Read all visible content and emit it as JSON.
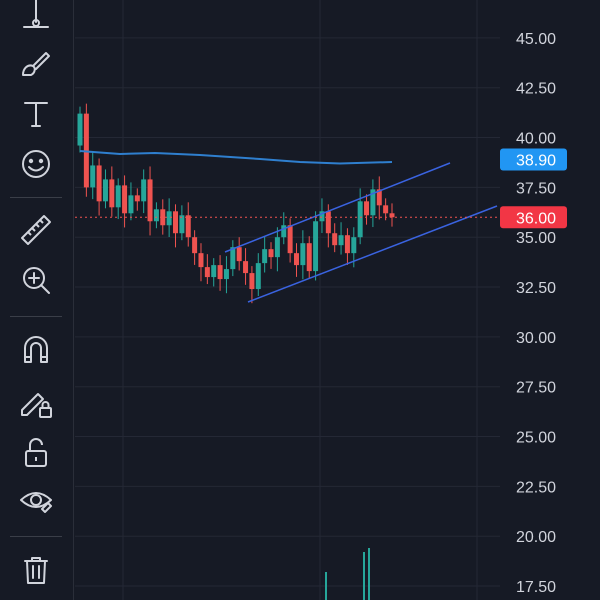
{
  "toolbar": {
    "tools": [
      {
        "name": "vertical-line-tool-icon"
      },
      {
        "name": "brush-tool-icon"
      },
      {
        "name": "text-tool-icon"
      },
      {
        "name": "emoji-tool-icon"
      },
      {
        "name": "ruler-tool-icon"
      },
      {
        "name": "zoom-in-tool-icon"
      },
      {
        "name": "magnet-tool-icon"
      },
      {
        "name": "lock-drawing-tool-icon"
      },
      {
        "name": "unlock-tool-icon"
      },
      {
        "name": "hide-drawings-tool-icon"
      },
      {
        "name": "delete-tool-icon"
      }
    ]
  },
  "colors": {
    "background": "#161a25",
    "grid": "#242835",
    "up": "#26a69a",
    "down": "#ef5350",
    "ma_line": "#2f7fcf",
    "channel": "#3a63e0",
    "current_price_tag": "#f23645",
    "ma_price_tag": "#2196f3",
    "axis_text": "#d1d4dc"
  },
  "price_axis": {
    "labels": [
      "45.00",
      "42.50",
      "40.00",
      "37.50",
      "35.00",
      "32.50",
      "30.00",
      "27.50",
      "25.00",
      "22.50",
      "20.00",
      "17.50"
    ]
  },
  "tags": {
    "ma_price": "38.90",
    "current_price": "36.00"
  },
  "chart_data": {
    "type": "candlestick",
    "ylim": [
      16.8,
      46.9
    ],
    "grid": true,
    "current_price": 36.0,
    "moving_average_last": 38.9,
    "candles_approx_closes": [
      41.2,
      37.5,
      38.6,
      36.8,
      37.9,
      36.5,
      37.6,
      36.2,
      37.1,
      36.8,
      37.9,
      35.8,
      36.4,
      35.6,
      36.3,
      35.2,
      36.1,
      35.0,
      34.2,
      33.5,
      33.0,
      33.6,
      32.9,
      33.4,
      34.5,
      33.8,
      33.2,
      32.4,
      33.7,
      34.4,
      34.0,
      35.0,
      35.6,
      34.2,
      33.6,
      34.7,
      33.3,
      35.8,
      36.3,
      35.2,
      34.6,
      35.1,
      34.2,
      35.0,
      36.8,
      36.1,
      37.4,
      36.6,
      36.2,
      36.0
    ]
  }
}
